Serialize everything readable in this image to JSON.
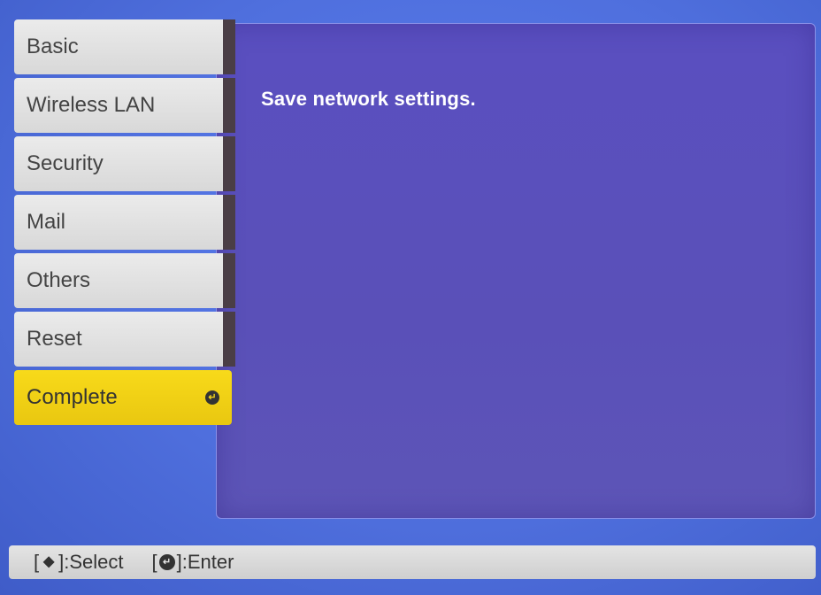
{
  "menu": {
    "items": [
      {
        "label": "Basic"
      },
      {
        "label": "Wireless LAN"
      },
      {
        "label": "Security"
      },
      {
        "label": "Mail"
      },
      {
        "label": "Others"
      },
      {
        "label": "Reset"
      },
      {
        "label": "Complete",
        "selected": true
      }
    ]
  },
  "panel": {
    "message": "Save network settings."
  },
  "status_bar": {
    "select_open": "[",
    "select_close": "]:Select",
    "enter_open": "[",
    "enter_close": "]:Enter"
  },
  "colors": {
    "background": "#4f6fe0",
    "panel": "#5a4fc0",
    "selected": "#f3d416",
    "menu_item": "#e2e2e2"
  }
}
